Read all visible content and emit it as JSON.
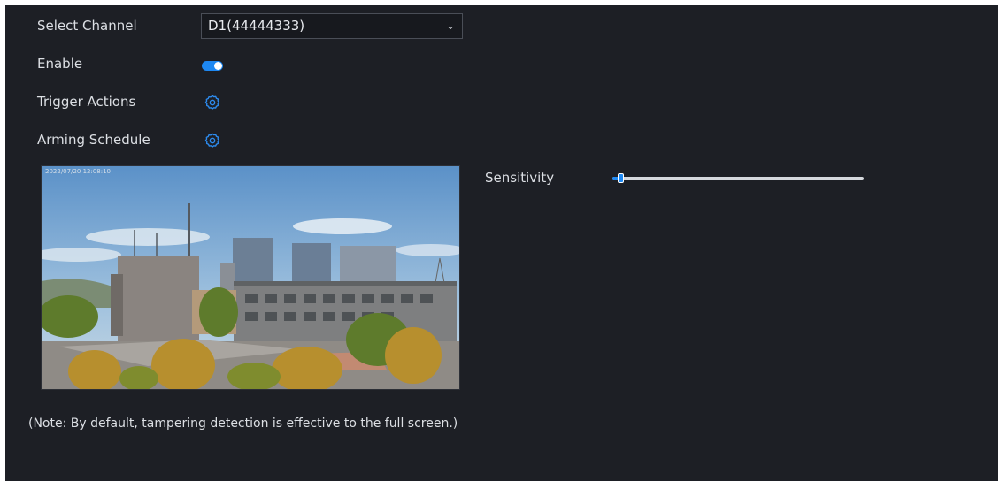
{
  "form": {
    "select_channel_label": "Select Channel",
    "channel_value": "D1(44444333)",
    "enable_label": "Enable",
    "enable_on": true,
    "trigger_actions_label": "Trigger Actions",
    "arming_schedule_label": "Arming Schedule"
  },
  "preview": {
    "osd_text": "2022/07/20 12:08:10"
  },
  "sensitivity": {
    "label": "Sensitivity",
    "value_fraction": 0.03
  },
  "note": "(Note: By default, tampering detection is effective to the full screen.)",
  "colors": {
    "background": "#1d1f25",
    "accent": "#1e88f2",
    "text": "#dcdfe4"
  },
  "icons": {
    "dropdown": "chevron-down-icon",
    "trigger_actions": "gear-icon",
    "arming_schedule": "gear-icon"
  }
}
